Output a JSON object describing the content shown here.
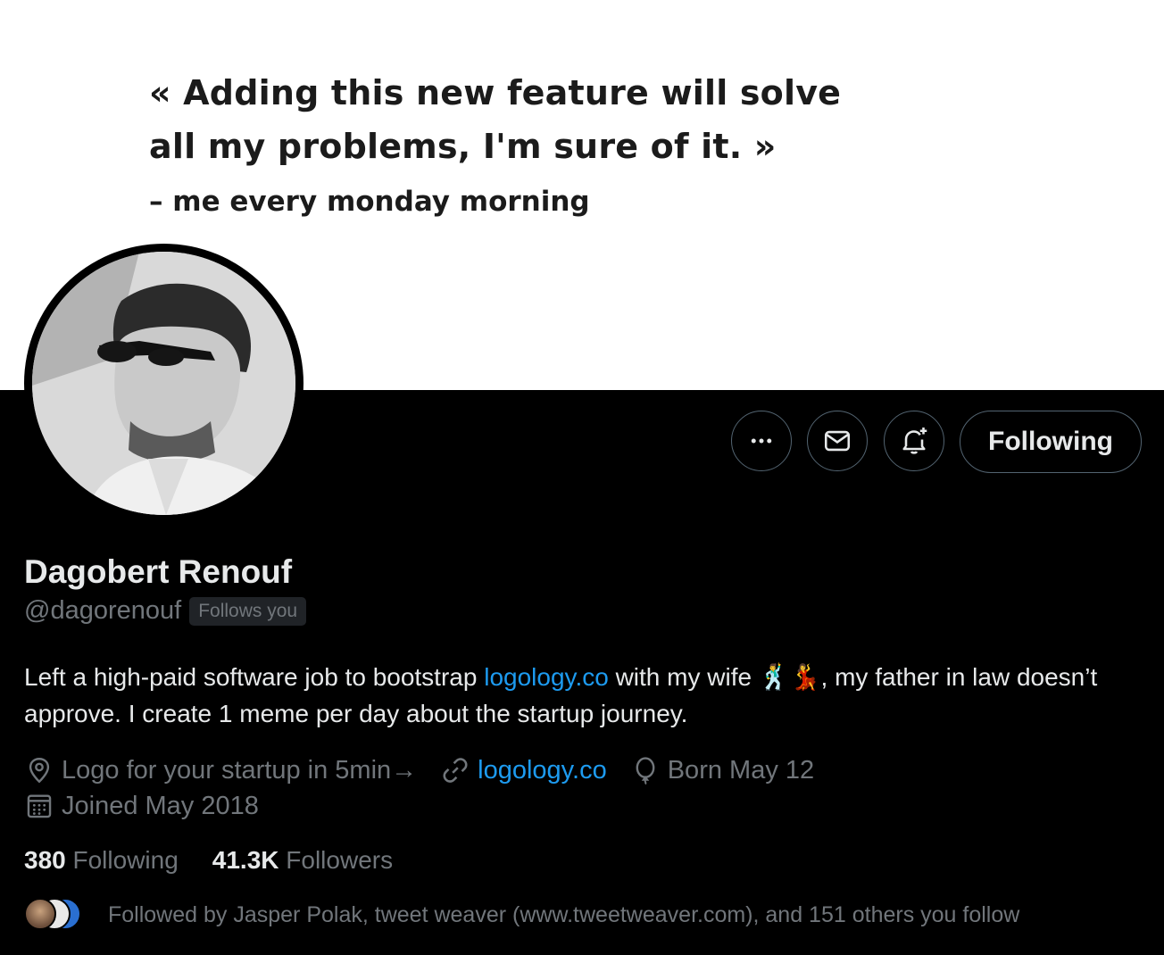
{
  "banner": {
    "quote": "« Adding this new feature will solve all my problems, I'm sure of it. »",
    "author": "– me every monday morning"
  },
  "actions": {
    "more_icon": "more-horizontal-icon",
    "message_icon": "envelope-icon",
    "notify_icon": "bell-plus-icon",
    "following_label": "Following"
  },
  "profile": {
    "name": "Dagobert Renouf",
    "handle": "@dagorenouf",
    "follows_you": "Follows you",
    "bio_part1": "Left a high-paid software job to bootstrap ",
    "bio_link": "logology.co",
    "bio_part2": " with my wife 🕺💃, my father in law doesn’t approve. I create 1 meme per day about the startup journey.",
    "location": "Logo for your startup in 5min→",
    "website": "logology.co",
    "birthday": "Born May 12",
    "joined": "Joined May 2018",
    "following_count": "380",
    "following_label": "Following",
    "followers_count": "41.3K",
    "followers_label": "Followers",
    "followed_by": "Followed by Jasper Polak, tweet weaver (www.tweetweaver.com), and 151 others you follow"
  },
  "colors": {
    "background": "#000000",
    "text": "#e7e9ea",
    "muted": "#71767b",
    "link": "#1d9bf0",
    "border": "#536471"
  }
}
